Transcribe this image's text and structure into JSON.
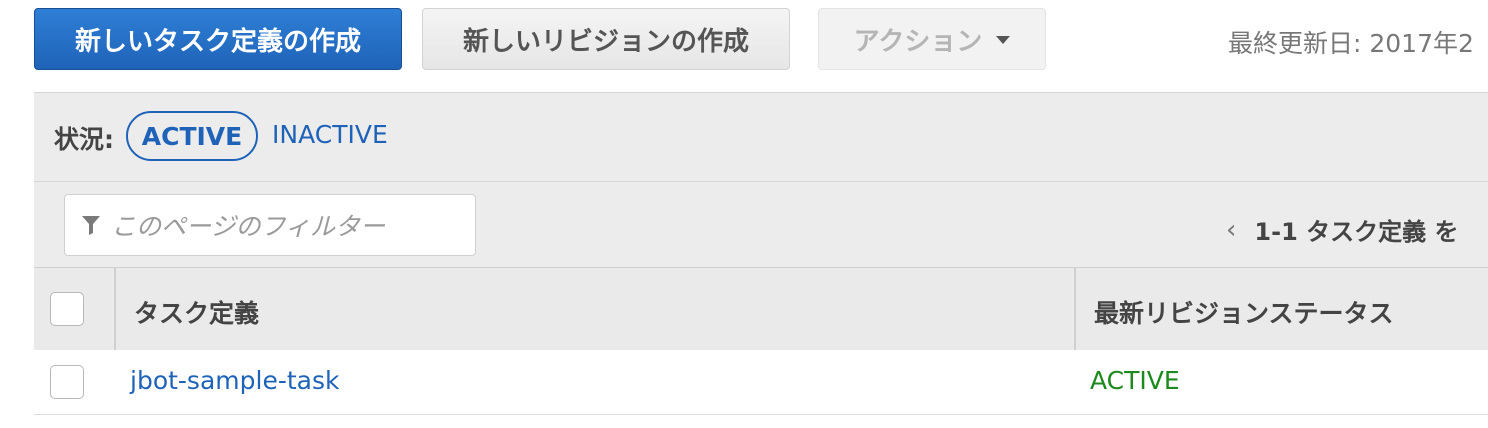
{
  "toolbar": {
    "create_task_definition": "新しいタスク定義の作成",
    "create_revision": "新しいリビジョンの作成",
    "actions": "アクション",
    "last_updated": "最終更新日: 2017年2"
  },
  "status_filter": {
    "label": "状況:",
    "active": "ACTIVE",
    "inactive": "INACTIVE"
  },
  "filter": {
    "placeholder": "このページのフィルター"
  },
  "pagination": {
    "prev_icon": "chevron-left-icon",
    "summary": "1-1 タスク定義 を"
  },
  "table": {
    "columns": [
      "タスク定義",
      "最新リビジョンステータス"
    ],
    "rows": [
      {
        "task_definition": "jbot-sample-task",
        "status": "ACTIVE"
      }
    ]
  },
  "colors": {
    "primary": "#1f63b8",
    "link": "#1f63b8",
    "status_active": "#1d8a1d"
  }
}
